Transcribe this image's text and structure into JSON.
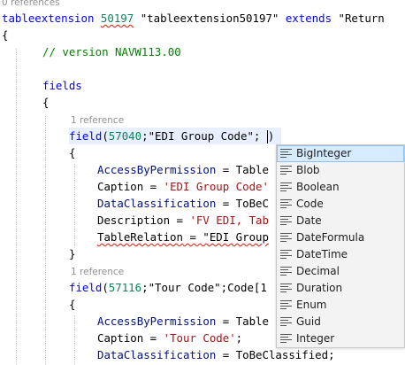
{
  "codelens_top": "0 references",
  "codelens_ref1": "1 reference",
  "codelens_ref2": "1 reference",
  "code": {
    "l1_kw": "tableextension",
    "l1_id": "50197",
    "l1_name": "\"tableextension50197\"",
    "l1_ext": "extends",
    "l1_target": "\"Return",
    "open_brace": "{",
    "close_brace": "}",
    "comment": "// version NAVW113.00",
    "fields_kw": "fields",
    "field_kw": "field",
    "f1_num": "57040",
    "f1_name": "\"EDI Group Code\"",
    "f1_partial_sep": ";",
    "f1_close": ")",
    "f1_props": [
      {
        "name": "AccessByPermission",
        "rest": " = Table"
      },
      {
        "name": "Caption",
        "rest": " = ",
        "str": "'EDI Group Code'"
      },
      {
        "name": "DataClassification",
        "rest": " = ToBeC"
      },
      {
        "name": "Description",
        "rest": " = ",
        "str": "'FV EDI, Tab"
      },
      {
        "name": "TableRelation",
        "rest": " = \"EDI Group"
      }
    ],
    "f2_num": "57116",
    "f2_name": "\"Tour Code\"",
    "f2_type": "Code[1",
    "f2_props": [
      {
        "name": "AccessByPermission",
        "rest": " = Table"
      },
      {
        "name": "Caption",
        "rest": " = ",
        "str": "'Tour Code'",
        "tail": ";"
      },
      {
        "name": "DataClassification",
        "rest": " = ToBeClassified;"
      }
    ]
  },
  "suggestions": [
    "BigInteger",
    "Blob",
    "Boolean",
    "Code",
    "Date",
    "DateFormula",
    "DateTime",
    "Decimal",
    "Duration",
    "Enum",
    "Guid",
    "Integer"
  ],
  "selected_suggestion": "BigInteger",
  "icon_name": "type-parameter-icon"
}
